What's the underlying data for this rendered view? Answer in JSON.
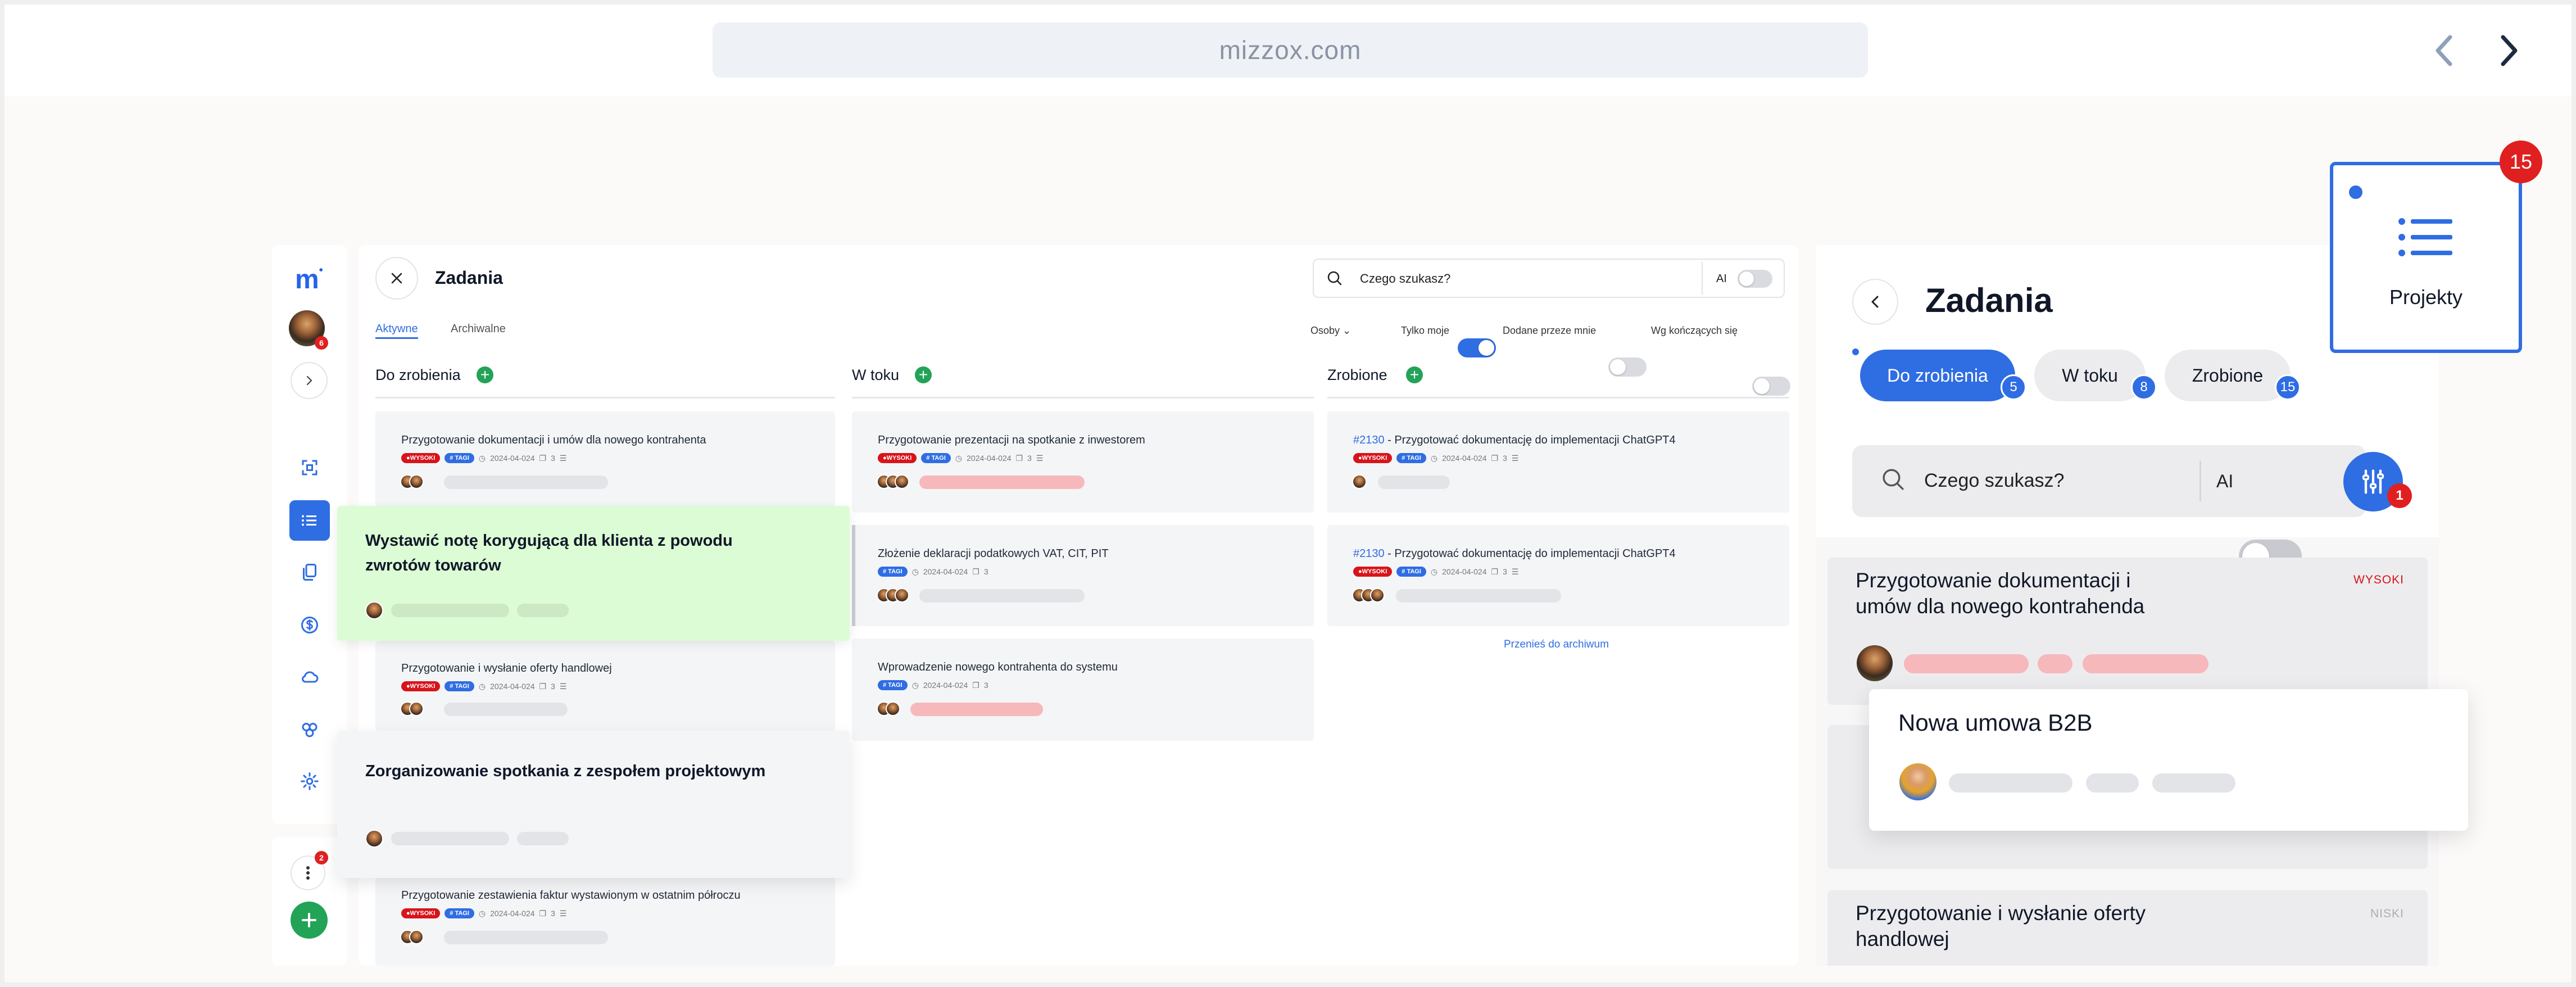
{
  "browser": {
    "url": "mizzox.com"
  },
  "sidebar": {
    "logo": "m",
    "avatar_badge": "6",
    "more_badge": "2"
  },
  "main": {
    "title": "Zadania",
    "tabs": [
      {
        "label": "Aktywne",
        "active": true
      },
      {
        "label": "Archiwalne",
        "active": false
      }
    ],
    "search": {
      "placeholder": "Czego szukasz?",
      "ai_label": "AI"
    },
    "filters": {
      "people": "Osoby",
      "only_mine": "Tylko moje",
      "added_by_me": "Dodane przeze mnie",
      "ending": "Wg kończących się"
    },
    "columns": [
      {
        "title": "Do zrobienia",
        "cards": [
          {
            "title": "Przygotowanie dokumentacji i umów dla nowego kontrahenta",
            "priority": "WYSOKI",
            "tag": "# TAGI",
            "date": "2024-04-024",
            "count": "3"
          },
          {
            "title": "Przygotowanie i wysłanie oferty handlowej",
            "priority": "WYSOKI",
            "tag": "# TAGI",
            "date": "2024-04-024",
            "count": "3"
          },
          {
            "title": "Przygotowanie zestawienia faktur wystawionym w ostatnim półroczu",
            "priority": "WYSOKI",
            "tag": "# TAGI",
            "date": "2024-04-024",
            "count": "3"
          }
        ]
      },
      {
        "title": "W toku",
        "cards": [
          {
            "title": "Przygotowanie prezentacji na spotkanie z inwestorem",
            "priority": "WYSOKI",
            "tag": "# TAGI",
            "date": "2024-04-024",
            "count": "3"
          },
          {
            "title": "Złożenie deklaracji podatkowych VAT, CIT, PIT",
            "tag": "# TAGI",
            "date": "2024-04-024",
            "count": "3"
          },
          {
            "title": "Wprowadzenie nowego kontrahenta do systemu",
            "tag": "# TAGI",
            "date": "2024-04-024",
            "count": "3"
          }
        ]
      },
      {
        "title": "Zrobione",
        "cards": [
          {
            "id": "#2130",
            "title": " - Przygotować dokumentację do implementacji ChatGPT4",
            "priority": "WYSOKI",
            "tag": "# TAGI",
            "date": "2024-04-024",
            "count": "3"
          },
          {
            "id": "#2130",
            "title": " - Przygotować dokumentację do implementacji ChatGPT4",
            "priority": "WYSOKI",
            "tag": "# TAGI",
            "date": "2024-04-024",
            "count": "3"
          }
        ],
        "archive_link": "Przenieś do archiwum"
      }
    ],
    "drag_cards": [
      {
        "title_line1": "Wystawić notę korygującą dla klienta z powodu",
        "title_line2": "zwrotów towarów"
      },
      {
        "title_line1": "Zorganizowanie spotkania z zespołem projektowym"
      }
    ]
  },
  "right_panel": {
    "title": "Zadania",
    "segments": [
      {
        "label": "Do zrobienia",
        "count": "5",
        "active": true
      },
      {
        "label": "W toku",
        "count": "8",
        "active": false
      },
      {
        "label": "Zrobione",
        "count": "15",
        "active": false
      }
    ],
    "search": {
      "placeholder": "Czego szukasz?",
      "ai_label": "AI"
    },
    "filter_badge": "1",
    "cards": [
      {
        "title_line1": "Przygotowanie dokumentacji i",
        "title_line2": "umów dla nowego kontrahenda",
        "priority": "WYSOKI"
      },
      {
        "title_line1": "Przygotowanie i wysłanie oferty",
        "title_line2": "handlowej",
        "priority": "NISKI"
      }
    ],
    "floating_card": {
      "title": "Nowa umowa B2B"
    }
  },
  "projects_widget": {
    "label": "Projekty",
    "badge": "15"
  },
  "colors": {
    "accent": "#2f6de3",
    "high_priority": "#d7141a",
    "add": "#22a358",
    "drag_green": "#dcfcd5"
  }
}
